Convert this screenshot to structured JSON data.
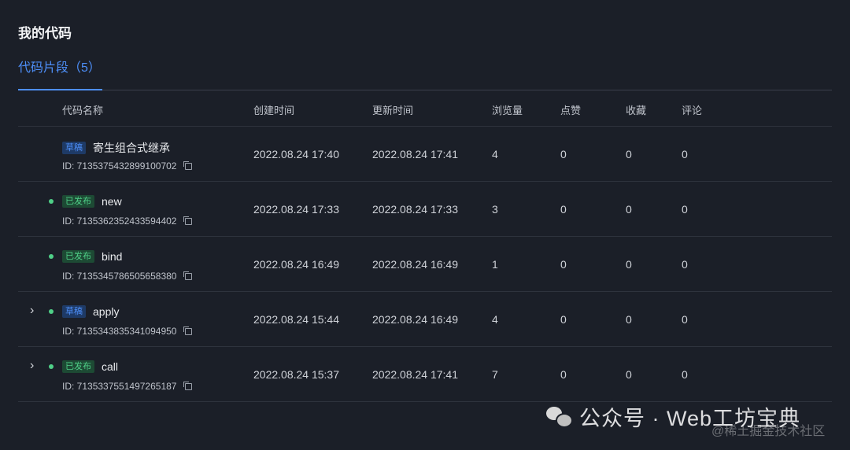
{
  "page": {
    "title": "我的代码"
  },
  "tabs": [
    {
      "label": "代码片段（5）"
    }
  ],
  "table": {
    "headers": {
      "name": "代码名称",
      "created": "创建时间",
      "updated": "更新时间",
      "views": "浏览量",
      "likes": "点赞",
      "favorites": "收藏",
      "comments": "评论"
    },
    "rows": [
      {
        "status": "草稿",
        "title": "寄生组合式继承",
        "id": "ID: 7135375432899100702",
        "created": "2022.08.24 17:40",
        "updated": "2022.08.24 17:41",
        "views": "4",
        "likes": "0",
        "favorites": "0",
        "comments": "0"
      },
      {
        "status": "已发布",
        "title": "new",
        "id": "ID: 7135362352433594402",
        "created": "2022.08.24 17:33",
        "updated": "2022.08.24 17:33",
        "views": "3",
        "likes": "0",
        "favorites": "0",
        "comments": "0"
      },
      {
        "status": "已发布",
        "title": "bind",
        "id": "ID: 7135345786505658380",
        "created": "2022.08.24 16:49",
        "updated": "2022.08.24 16:49",
        "views": "1",
        "likes": "0",
        "favorites": "0",
        "comments": "0"
      },
      {
        "status": "草稿",
        "title": "apply",
        "id": "ID: 7135343835341094950",
        "created": "2022.08.24 15:44",
        "updated": "2022.08.24 16:49",
        "views": "4",
        "likes": "0",
        "favorites": "0",
        "comments": "0"
      },
      {
        "status": "已发布",
        "title": "call",
        "id": "ID: 7135337551497265187",
        "created": "2022.08.24 15:37",
        "updated": "2022.08.24 17:41",
        "views": "7",
        "likes": "0",
        "favorites": "0",
        "comments": "0"
      }
    ]
  },
  "icons": {
    "expand": "chevron-right-icon",
    "copy": "copy-icon",
    "status_dot": "status-dot-icon",
    "wechat": "wechat-icon"
  },
  "colors": {
    "accent": "#4d8ef7",
    "published": "#4fcf87",
    "background": "#1b1f28"
  },
  "watermark": {
    "text": "公众号 · Web工坊宝典",
    "sub": "@稀土掘金技术社区"
  }
}
